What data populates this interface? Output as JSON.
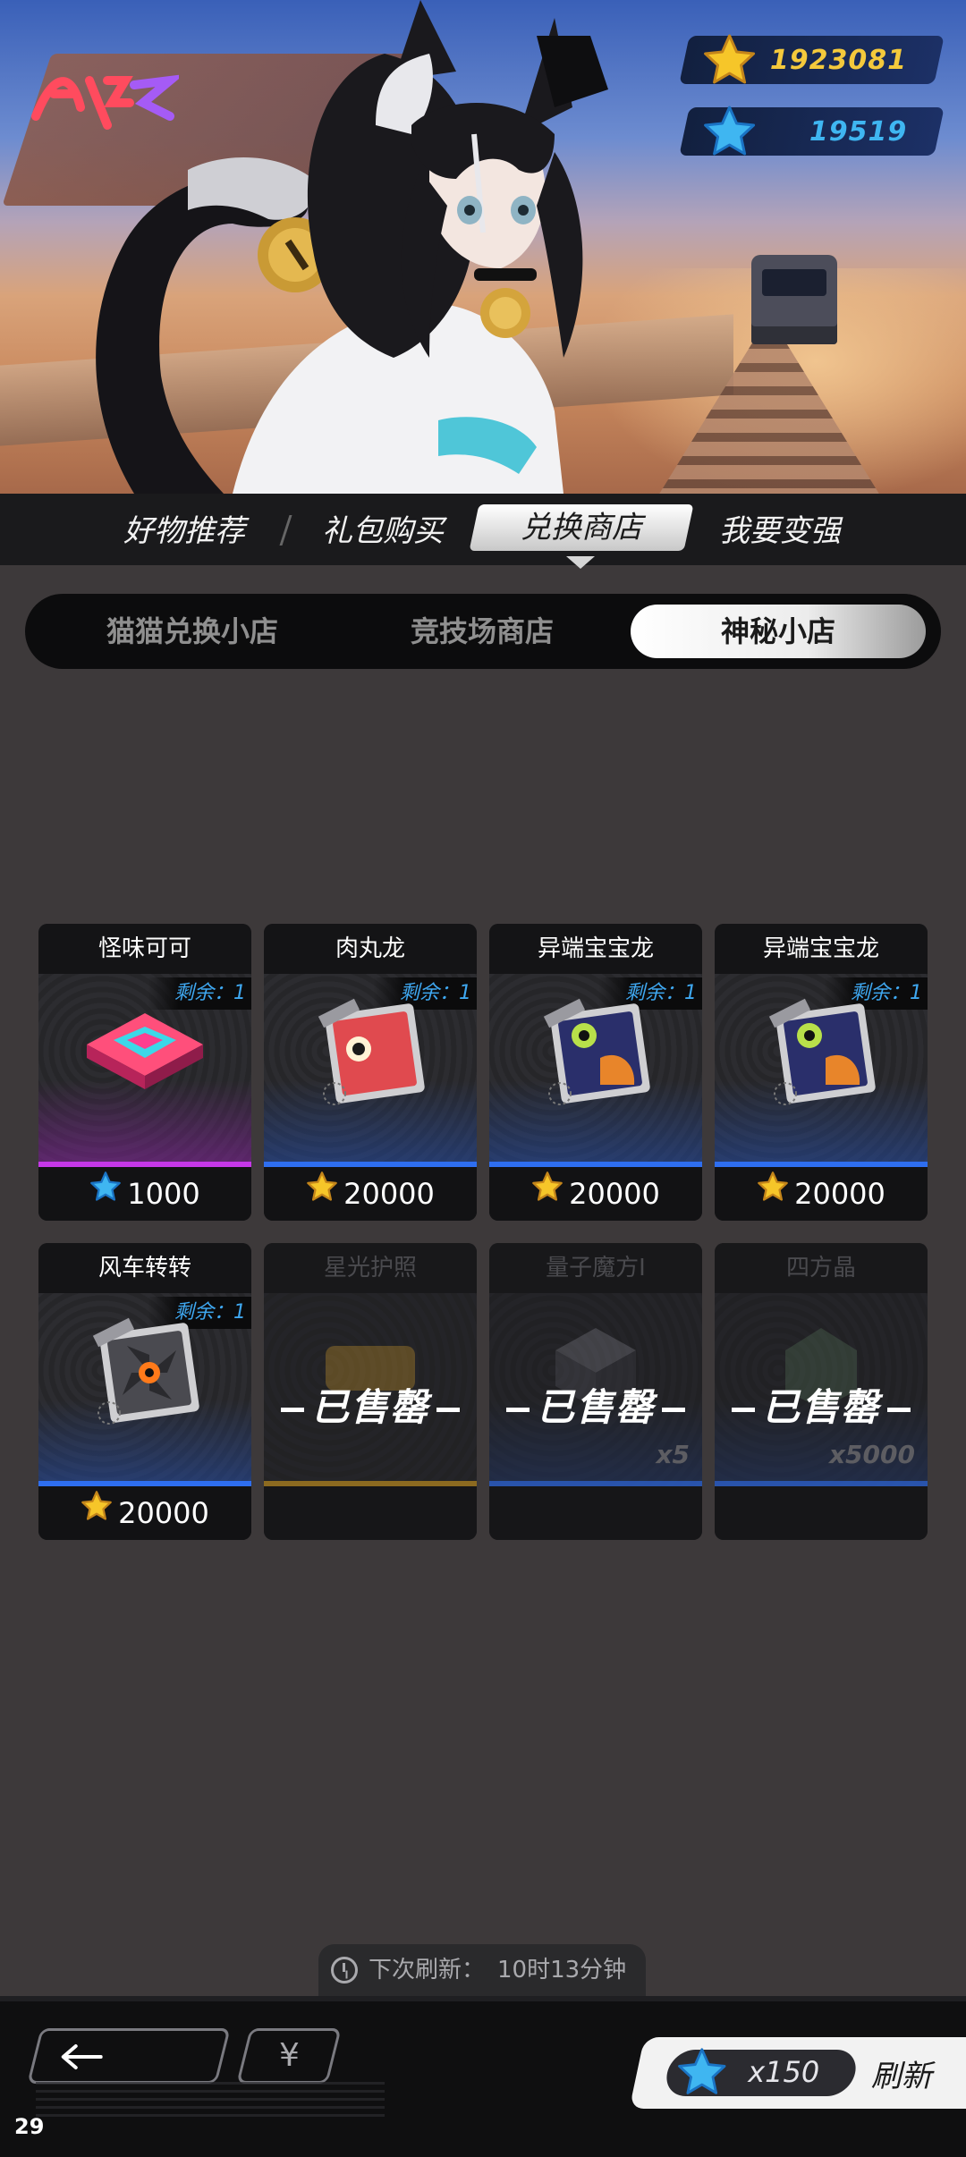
{
  "currency": {
    "stars": "1923081",
    "gems": "19519"
  },
  "top_tabs": [
    {
      "label": "好物推荐",
      "selected": false
    },
    {
      "label": "礼包购买",
      "selected": false
    },
    {
      "label": "兑换商店",
      "selected": true
    },
    {
      "label": "我要变强",
      "selected": false
    }
  ],
  "sub_tabs": [
    {
      "label": "猫猫兑换小店",
      "selected": false
    },
    {
      "label": "竞技场商店",
      "selected": false
    },
    {
      "label": "神秘小店",
      "selected": true
    }
  ],
  "items": [
    {
      "name": "怪味可可",
      "remain": "剩余：1",
      "price": "1000",
      "currency": "gem",
      "sold": false,
      "icon": "cocoa-box-icon"
    },
    {
      "name": "肉丸龙",
      "remain": "剩余：1",
      "price": "20000",
      "currency": "star",
      "sold": false,
      "icon": "meatball-dragon-card-icon"
    },
    {
      "name": "异端宝宝龙",
      "remain": "剩余：1",
      "price": "20000",
      "currency": "star",
      "sold": false,
      "icon": "heretic-dragon-card-icon"
    },
    {
      "name": "异端宝宝龙",
      "remain": "剩余：1",
      "price": "20000",
      "currency": "star",
      "sold": false,
      "icon": "heretic-dragon-card-icon"
    },
    {
      "name": "风车转转",
      "remain": "剩余：1",
      "price": "20000",
      "currency": "star",
      "sold": false,
      "icon": "pinwheel-card-icon"
    },
    {
      "name": "星光护照",
      "sold": true,
      "sold_label": "已售罄",
      "qty": "",
      "icon": "passport-icon"
    },
    {
      "name": "量子魔方I",
      "sold": true,
      "sold_label": "已售罄",
      "qty": "x5",
      "icon": "quantum-cube-icon"
    },
    {
      "name": "四方晶",
      "sold": true,
      "sold_label": "已售罄",
      "qty": "x5000",
      "icon": "crystal-icon"
    }
  ],
  "refresh_info": {
    "label": "下次刷新：",
    "time": "10时13分钟"
  },
  "bottom": {
    "shop_symbol": "¥",
    "refresh_cost": "x150",
    "refresh_label": "刷新"
  },
  "fps": "29",
  "colors": {
    "star": "#f4c93c",
    "gem": "#3fb6f1",
    "accent_purple": "#c637e8",
    "accent_blue": "#2e6ef0"
  }
}
